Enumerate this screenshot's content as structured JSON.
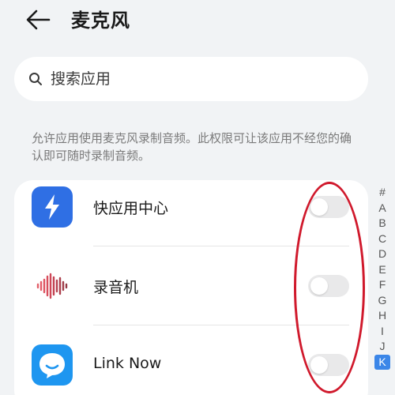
{
  "header": {
    "back_icon": "arrow-left-icon",
    "title": "麦克风"
  },
  "search": {
    "icon": "search-icon",
    "placeholder": "搜索应用",
    "value": ""
  },
  "description": "允许应用使用麦克风录制音频。此权限可让该应用不经您的确认即可随时录制音频。",
  "apps": [
    {
      "name": "快应用中心",
      "icon": "quick-app-center-icon",
      "enabled": false
    },
    {
      "name": "录音机",
      "icon": "sound-recorder-icon",
      "enabled": false
    },
    {
      "name": "Link Now",
      "icon": "link-now-icon",
      "enabled": false
    }
  ],
  "alpha_index": {
    "letters": [
      "#",
      "A",
      "B",
      "C",
      "D",
      "E",
      "F",
      "G",
      "H",
      "I",
      "J",
      "K"
    ],
    "active": "K"
  },
  "colors": {
    "background": "#f1f3f5",
    "card": "#ffffff",
    "accent": "#3b86e8",
    "annotation": "#d0192c",
    "toggle_off": "#e9e9ea",
    "description_text": "#7a7a7a"
  }
}
